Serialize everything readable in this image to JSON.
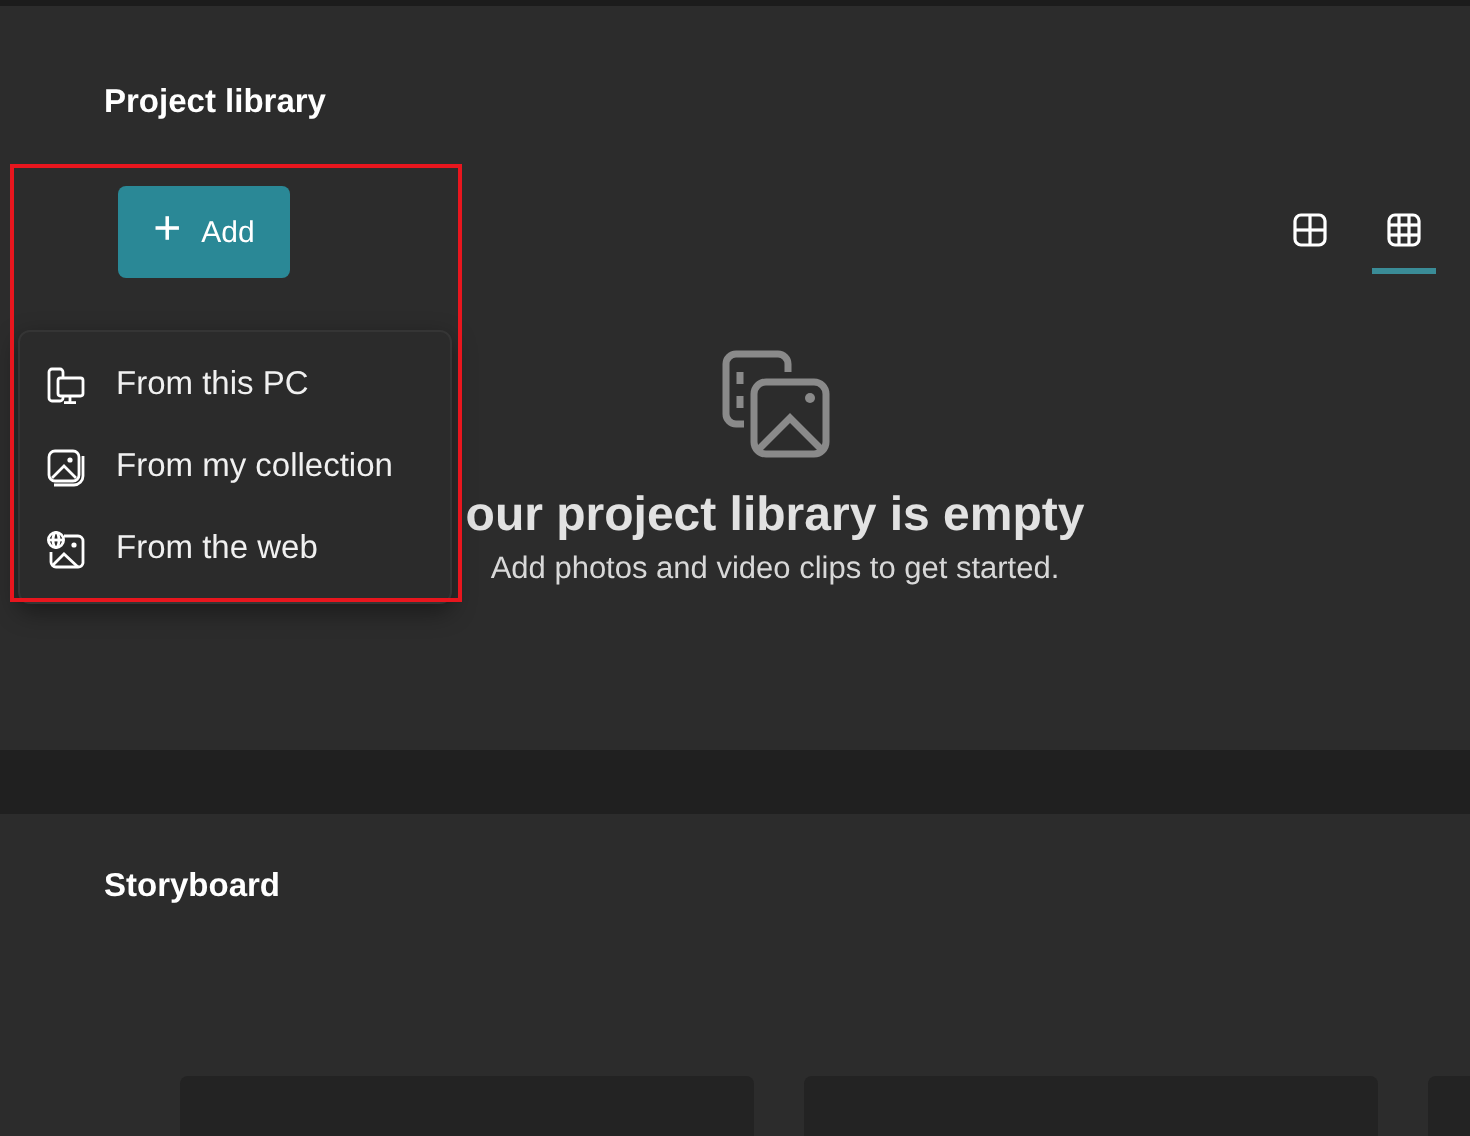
{
  "project_library": {
    "title": "Project library",
    "add_button": {
      "label": "Add",
      "icon": "+"
    },
    "add_menu": [
      {
        "kind": "pc",
        "label": "From this PC"
      },
      {
        "kind": "collection",
        "label": "From my collection"
      },
      {
        "kind": "web",
        "label": "From the web"
      }
    ],
    "view_tabs": [
      {
        "kind": "large",
        "selected": false
      },
      {
        "kind": "small",
        "selected": true
      }
    ],
    "empty_title": "our project library is empty",
    "empty_hint": "Add photos and video clips to get started."
  },
  "storyboard": {
    "title": "Storyboard",
    "slots": [
      {
        "kind": "empty"
      },
      {
        "kind": "empty"
      },
      {
        "kind": "empty"
      }
    ]
  }
}
